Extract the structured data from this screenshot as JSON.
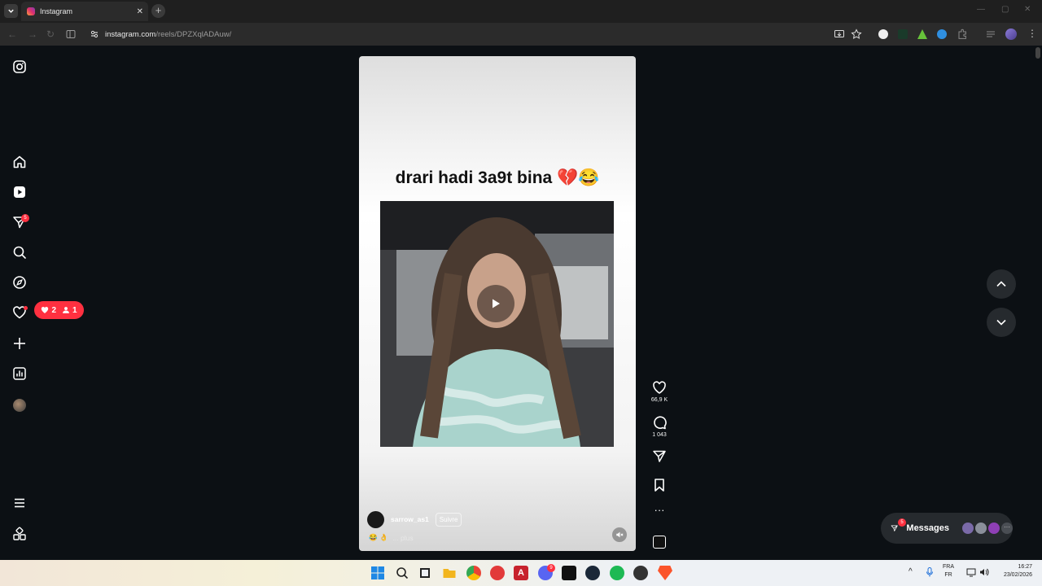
{
  "browser": {
    "tab_title": "Instagram",
    "url_host": "instagram.com",
    "url_path": "/reels/DPZXqlADAuw/"
  },
  "sidebar": {
    "notifications_badge": "5",
    "activity_likes": "2",
    "activity_follows": "1"
  },
  "reel": {
    "caption_overlay": "drari hadi 3a9t bina 💔😂",
    "author": "sarrow_as1",
    "follow_label": "Suivre",
    "caption_emojis": "😂 👌",
    "caption_more": "... plus",
    "likes": "66,9 K",
    "comments": "1 043"
  },
  "messages": {
    "label": "Messages",
    "badge": "5"
  },
  "taskbar": {
    "lang_top": "FRA",
    "lang_bottom": "FR",
    "time": "16:27",
    "date": "23/02/2026",
    "discord_badge": "9"
  },
  "colors": {
    "background": "#0c1014",
    "badge": "#ff3040",
    "accent": "#ffffff"
  }
}
